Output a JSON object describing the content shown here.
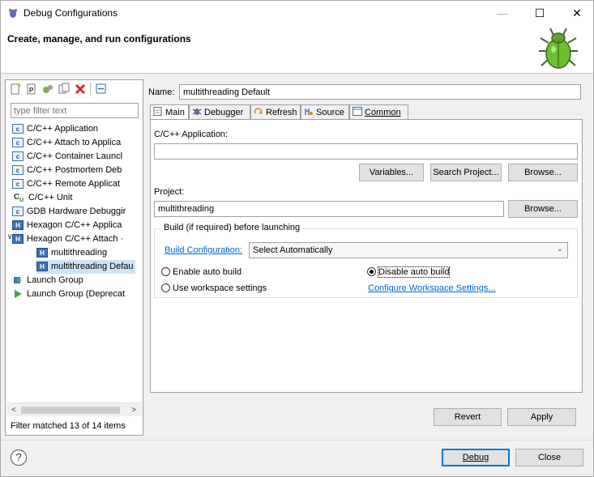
{
  "window": {
    "title": "Debug Configurations",
    "banner_title": "Create, manage, and run configurations",
    "minimize": "—",
    "maximize": "☐",
    "close": "✕"
  },
  "left": {
    "filter_placeholder": "type filter text",
    "tree": [
      {
        "label": "C/C++ Application",
        "icon": "c-app-icon"
      },
      {
        "label": "C/C++ Attach to Applica",
        "icon": "c-app-icon"
      },
      {
        "label": "C/C++ Container Launcl",
        "icon": "c-app-icon"
      },
      {
        "label": "C/C++ Postmortem Deb",
        "icon": "c-app-icon"
      },
      {
        "label": "C/C++ Remote Applicat",
        "icon": "c-app-icon"
      },
      {
        "label": "C/C++ Unit",
        "icon": "cunit-icon"
      },
      {
        "label": "GDB Hardware Debuggir",
        "icon": "c-app-icon"
      },
      {
        "label": "Hexagon C/C++ Applica",
        "icon": "hexagon-icon"
      },
      {
        "label": "Hexagon C/C++ Attach ·",
        "icon": "hexagon-icon"
      },
      {
        "label": "multithreading",
        "icon": "hexagon-icon"
      },
      {
        "label": "multithreading Defau",
        "icon": "hexagon-icon"
      },
      {
        "label": "Launch Group",
        "icon": "launch-group-icon"
      },
      {
        "label": "Launch Group (Deprecat",
        "icon": "launch-play-icon"
      }
    ],
    "filter_status": "Filter matched 13 of 14 items"
  },
  "right": {
    "name_label": "Name:",
    "name_value": "multithreading Default",
    "tabs": [
      "Main",
      "Debugger",
      "Refresh",
      "Source",
      "Common"
    ],
    "cpp_app_label": "C/C++ Application:",
    "cpp_app_value": "",
    "variables_btn": "Variables...",
    "search_project_btn": "Search Project...",
    "browse_btn": "Browse...",
    "project_label": "Project:",
    "project_value": "multithreading",
    "project_browse_btn": "Browse...",
    "build_group_title": "Build (if required) before launching",
    "build_config_link": "Build Configuration:",
    "build_config_value": "Select Automatically",
    "radio_enable": "Enable auto build",
    "radio_disable": "Disable auto build",
    "radio_workspace": "Use workspace settings",
    "configure_link": "Configure Workspace Settings...",
    "revert_btn": "Revert",
    "apply_btn": "Apply"
  },
  "footer": {
    "help": "?",
    "debug_btn": "Debug",
    "close_btn": "Close"
  }
}
